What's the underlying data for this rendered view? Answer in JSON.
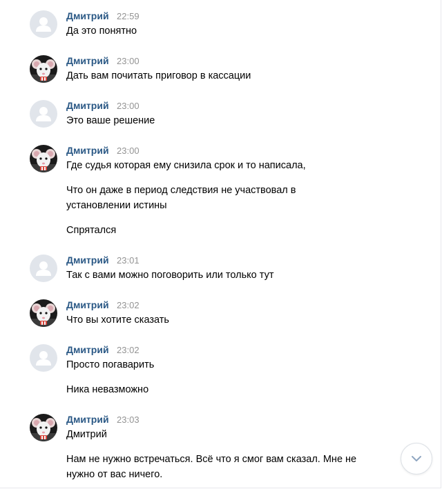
{
  "accent_name_color": "#2a5885",
  "time_color": "#939393",
  "messages": [
    {
      "author": "Дмитрий",
      "time": "22:59",
      "avatar": "default-user-avatar",
      "lines": [
        "Да это понятно"
      ]
    },
    {
      "author": "Дмитрий",
      "time": "23:00",
      "avatar": "rat-photo-avatar",
      "lines": [
        "Дать вам почитать приговор в кассации"
      ]
    },
    {
      "author": "Дмитрий",
      "time": "23:00",
      "avatar": "default-user-avatar",
      "lines": [
        "Это ваше решение"
      ]
    },
    {
      "author": "Дмитрий",
      "time": "23:00",
      "avatar": "rat-photo-avatar",
      "lines": [
        "Где судья которая ему снизила срок и то написала,",
        "Что он даже в период следствия не участвовал в",
        "установлении истины",
        "Спрятался"
      ]
    },
    {
      "author": "Дмитрий",
      "time": "23:01",
      "avatar": "default-user-avatar",
      "lines": [
        "Так с вами можно поговорить или только тут"
      ]
    },
    {
      "author": "Дмитрий",
      "time": "23:02",
      "avatar": "rat-photo-avatar",
      "lines": [
        "Что вы хотите сказать"
      ]
    },
    {
      "author": "Дмитрий",
      "time": "23:02",
      "avatar": "default-user-avatar",
      "lines": [
        "Просто погаварить",
        "Ника невазможно"
      ]
    },
    {
      "author": "Дмитрий",
      "time": "23:03",
      "avatar": "rat-photo-avatar",
      "lines": [
        "Дмитрий",
        "Нам не нужно встречаться. Всё что я смог вам сказал. Мне не",
        "нужно от вас ничего."
      ]
    }
  ],
  "scroll_button": {
    "icon": "chevron-down-icon"
  }
}
